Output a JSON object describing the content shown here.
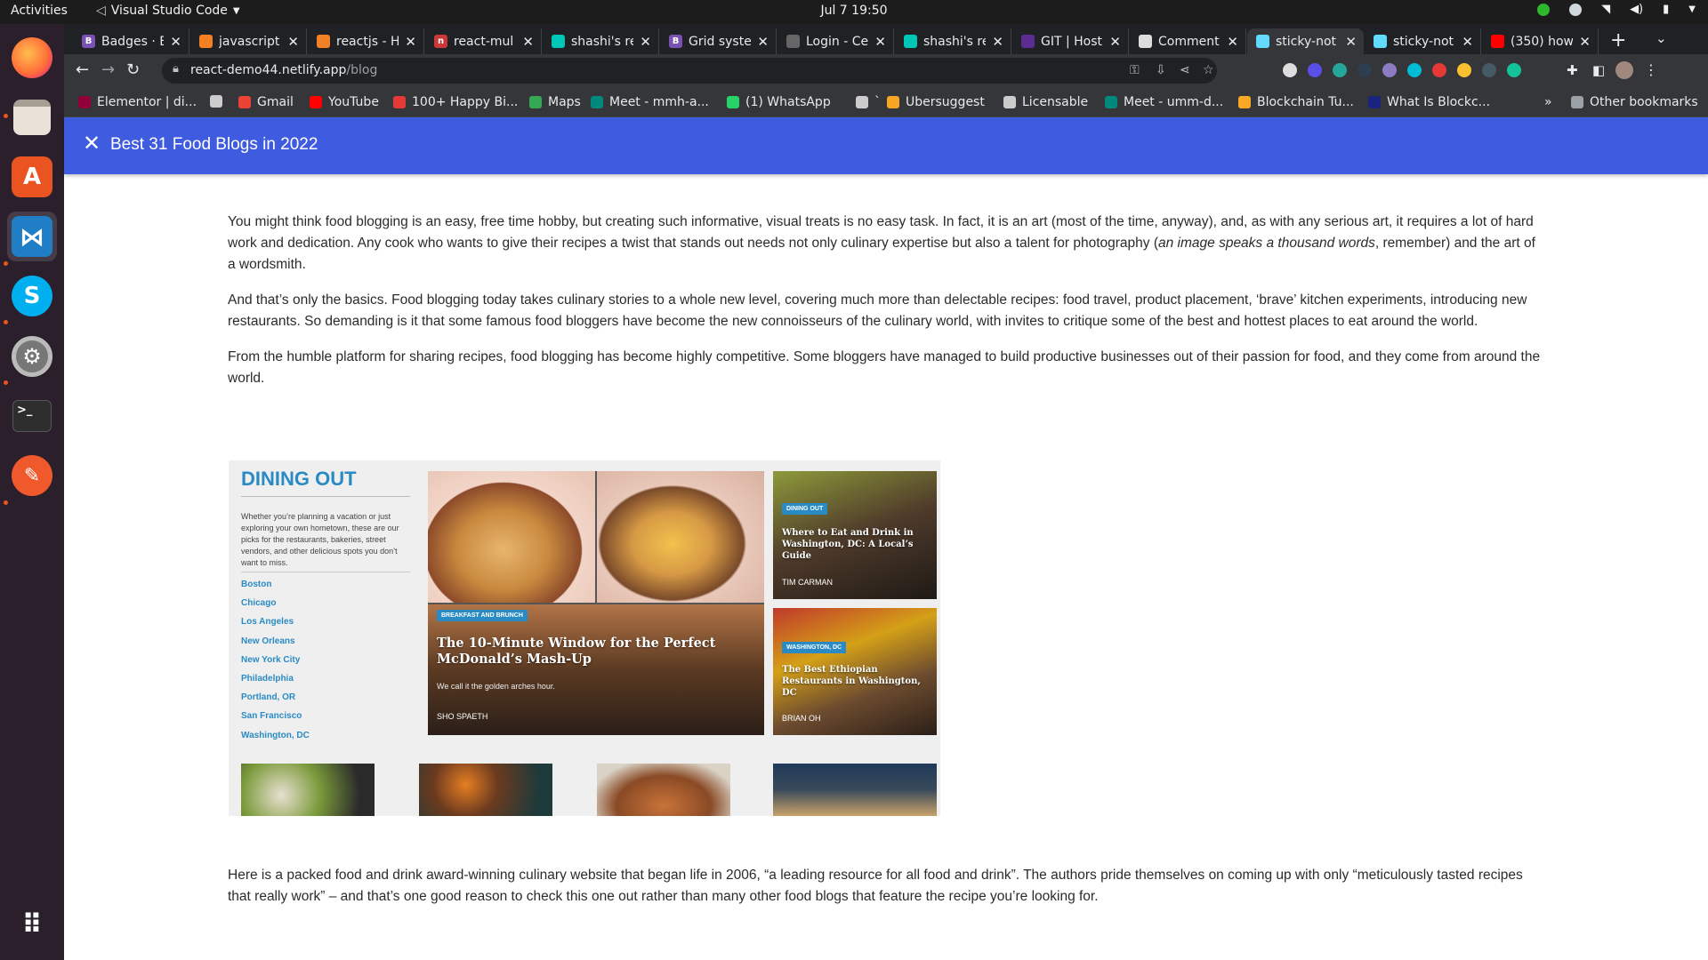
{
  "topbar": {
    "activities": "Activities",
    "app_name": "Visual Studio Code",
    "clock": "Jul 7  19:50"
  },
  "dock": {
    "items": [
      "firefox-icon",
      "files-icon",
      "app-center-icon",
      "vscode-icon",
      "skype-icon",
      "settings-icon",
      "terminal-icon",
      "pen-tool-icon"
    ],
    "apps_grid": "show-applications-icon"
  },
  "browser": {
    "tabs": [
      {
        "label": "Badges · B",
        "favicon": "B",
        "color": "#7952b3"
      },
      {
        "label": "javascript",
        "favicon": "",
        "color": "#f48024"
      },
      {
        "label": "reactjs - H",
        "favicon": "",
        "color": "#f48024"
      },
      {
        "label": "react-mul",
        "favicon": "n",
        "color": "#cb3837"
      },
      {
        "label": "shashi's re",
        "favicon": "",
        "color": "#00c7b7"
      },
      {
        "label": "Grid syste",
        "favicon": "B",
        "color": "#7952b3"
      },
      {
        "label": "Login - Ce",
        "favicon": "",
        "color": "#666666"
      },
      {
        "label": "shashi's re",
        "favicon": "",
        "color": "#00c7b7"
      },
      {
        "label": "GIT | Host",
        "favicon": "",
        "color": "#5c2d91"
      },
      {
        "label": "Comment",
        "favicon": "",
        "color": "#dddddd"
      },
      {
        "label": "sticky-not",
        "favicon": "",
        "color": "#61dafb",
        "active": true
      },
      {
        "label": "sticky-not",
        "favicon": "",
        "color": "#61dafb"
      },
      {
        "label": "(350) how",
        "favicon": "",
        "color": "#ff0000"
      }
    ],
    "url_host": "react-demo44.netlify.app",
    "url_path": "/blog",
    "bookmarks": [
      {
        "label": "Elementor | di...",
        "color": "#92003b"
      },
      {
        "label": "",
        "color": "#cccccc"
      },
      {
        "label": "Gmail",
        "color": "#ea4335"
      },
      {
        "label": "YouTube",
        "color": "#ff0000"
      },
      {
        "label": "100+ Happy Bi...",
        "color": "#e53935"
      },
      {
        "label": "Maps",
        "color": "#34a853"
      },
      {
        "label": "Meet - mmh-a...",
        "color": "#00897b"
      },
      {
        "label": "(1) WhatsApp",
        "color": "#25d366"
      },
      {
        "label": "`",
        "color": "#cccccc"
      },
      {
        "label": "Ubersuggest",
        "color": "#f5a623"
      },
      {
        "label": "Licensable",
        "color": "#cccccc"
      },
      {
        "label": "Meet - umm-d...",
        "color": "#00897b"
      },
      {
        "label": "Blockchain Tu...",
        "color": "#f9a825"
      },
      {
        "label": "What Is Blockc...",
        "color": "#1a237e"
      }
    ],
    "other_bookmarks": "Other bookmarks"
  },
  "page": {
    "title": "Best 31 Food Blogs in 2022",
    "paragraphs": [
      {
        "before": "You might think food blogging is an easy, free time hobby, but creating such informative, visual treats is no easy task. In fact, it is an art (most of the time, anyway), and, as with any serious art, it requires a lot of hard work and dedication. Any cook who wants to give their recipes a twist that stands out needs not only culinary expertise but also a talent for photography (",
        "em": "an image speaks a thousand words",
        "after": ", remember) and the art of a wordsmith."
      },
      {
        "before": "And that’s only the basics. Food blogging today takes culinary stories to a whole new level, covering much more than delectable recipes: food travel, product placement, ‘brave’ kitchen experiments, introducing new restaurants. So demanding is it that some famous food bloggers have become the new connoisseurs of the culinary world, with invites to critique some of the best and hottest places to eat around the world."
      },
      {
        "before": "From the humble platform for sharing recipes, food blogging has become highly competitive. Some bloggers have managed to build productive businesses out of their passion for food, and they come from around the world."
      }
    ],
    "after_image": "Here is a packed food and drink award-winning culinary website that began life in 2006, “a leading resource for all food and drink”. The authors pride themselves on coming up with only “meticulously tasted recipes that really work” – and that’s one good reason to check this one out rather than many other food blogs that feature the recipe you’re looking for."
  },
  "blog_image": {
    "heading": "DINING OUT",
    "intro": "Whether you’re planning a vacation or just exploring your own hometown, these are our picks for the restaurants, bakeries, street vendors, and other delicious spots you don’t want to miss.",
    "cities": [
      "Boston",
      "Chicago",
      "Los Angeles",
      "New Orleans",
      "New York City",
      "Philadelphia",
      "Portland, OR",
      "San Francisco",
      "Washington, DC"
    ],
    "main_card": {
      "tag": "BREAKFAST AND BRUNCH",
      "title": "The 10-Minute Window for the Perfect McDonald’s Mash-Up",
      "subtitle": "We call it the golden arches hour.",
      "author": "SHO SPAETH"
    },
    "card1": {
      "tag": "DINING OUT",
      "title": "Where to Eat and Drink in Washington, DC: A Local’s Guide",
      "author": "TIM CARMAN"
    },
    "card2": {
      "tag": "WASHINGTON, DC",
      "title": "The Best Ethiopian Restaurants in Washington, DC",
      "author": "BRIAN OH"
    }
  }
}
